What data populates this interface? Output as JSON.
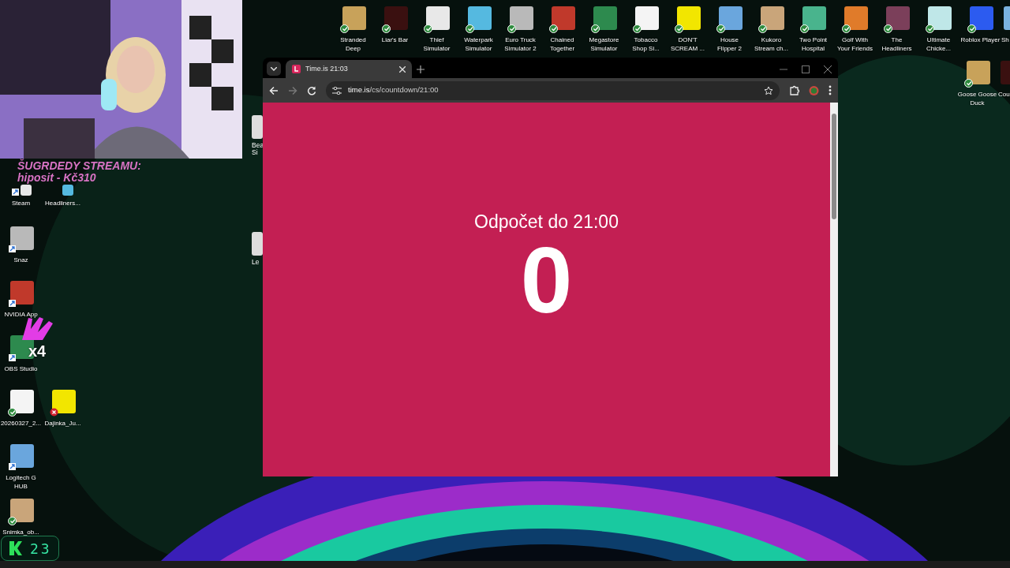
{
  "webcam": {
    "kind": "picture"
  },
  "stream_overlay": {
    "lines": [
      "ŠUGRDEDY STREAMU:",
      "hiposit - Kč310"
    ]
  },
  "top_icons": [
    {
      "label": [
        "Stranded",
        "Deep"
      ],
      "kind": "synced"
    },
    {
      "label": [
        "Liar's Bar"
      ],
      "kind": "synced"
    },
    {
      "label": [
        "Thief",
        "Simulator"
      ],
      "kind": "synced"
    },
    {
      "label": [
        "Waterpark",
        "Simulator"
      ],
      "kind": "synced"
    },
    {
      "label": [
        "Euro Truck",
        "Simulator 2"
      ],
      "kind": "synced"
    },
    {
      "label": [
        "Chained",
        "Together"
      ],
      "kind": "synced"
    },
    {
      "label": [
        "Megastore",
        "Simulator"
      ],
      "kind": "synced"
    },
    {
      "label": [
        "Tobacco",
        "Shop Si..."
      ],
      "kind": "synced"
    },
    {
      "label": [
        "DON'T",
        "SCREAM ..."
      ],
      "kind": "synced"
    },
    {
      "label": [
        "House",
        "Flipper 2"
      ],
      "kind": "synced"
    },
    {
      "label": [
        "Kukoro",
        "Stream ch..."
      ],
      "kind": "synced"
    },
    {
      "label": [
        "Two Point",
        "Hospital"
      ],
      "kind": "synced"
    },
    {
      "label": [
        "Golf With",
        "Your Friends"
      ],
      "kind": "synced"
    },
    {
      "label": [
        "The",
        "Headliners"
      ],
      "kind": "synced"
    },
    {
      "label": [
        "Ultimate",
        "Chicke..."
      ],
      "kind": "synced"
    },
    {
      "label": [
        "Roblox Player"
      ],
      "kind": "synced"
    },
    {
      "label": [
        "Sh"
      ],
      "kind": "plain"
    }
  ],
  "right_icons": [
    {
      "label": [
        "Goose Goose",
        "Duck"
      ],
      "kind": "synced"
    },
    {
      "label": [
        "Cou"
      ],
      "kind": "plain"
    }
  ],
  "left_icons": [
    [
      {
        "label": [
          "Steam"
        ],
        "kind": "shortcut"
      },
      {
        "label": [
          "Headliners..."
        ],
        "kind": "plain"
      }
    ],
    [
      {
        "label": [
          "Snaz"
        ],
        "kind": "shortcut"
      }
    ],
    [
      {
        "label": [
          "NVIDIA App"
        ],
        "kind": "shortcut"
      }
    ],
    [
      {
        "label": [
          "OBS Studio"
        ],
        "kind": "shortcut"
      }
    ],
    [
      {
        "label": [
          "20260327_2..."
        ],
        "kind": "synced"
      },
      {
        "label": [
          "Dajinka_Ju..."
        ],
        "kind": "error"
      }
    ],
    [
      {
        "label": [
          "Logitech G",
          "HUB"
        ],
        "kind": "shortcut"
      }
    ],
    [
      {
        "label": [
          "Snimka_ob..."
        ],
        "kind": "synced"
      }
    ]
  ],
  "partial_icons": [
    {
      "label": [
        "Bea",
        "Si"
      ]
    },
    {
      "label": [
        "Le"
      ]
    }
  ],
  "emote": {
    "multiplier": "x4"
  },
  "counter": {
    "value": "23"
  },
  "browser": {
    "tab": {
      "title": "Time.is 21:03",
      "selected": true
    },
    "url": {
      "host": "time.is",
      "path": "/cs/countdown/21:00"
    },
    "page": {
      "heading": "Odpočet do 21:00",
      "count": "0"
    }
  }
}
